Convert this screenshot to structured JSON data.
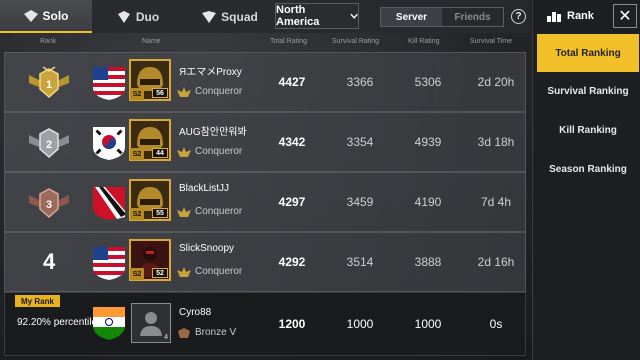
{
  "tabs": {
    "modes": [
      "Solo",
      "Duo",
      "Squad"
    ],
    "region": "North America",
    "scope_server": "Server",
    "scope_friends": "Friends",
    "help": "?"
  },
  "header": {
    "rank": "Rank",
    "name": "Name",
    "total": "Total Rating",
    "survival": "Survival Rating",
    "kill": "Kill Rating",
    "time": "Survival Time"
  },
  "rows": [
    {
      "rank": "1",
      "name": "ЯエマメProxy",
      "season": "S2",
      "level": "56",
      "tier": "Conqueror",
      "total": "4427",
      "survival": "3366",
      "kill": "5306",
      "time": "2d 20h",
      "flag_color": "#1f3f8f"
    },
    {
      "rank": "2",
      "name": "AUG참안만워봐",
      "season": "S2",
      "level": "44",
      "tier": "Conqueror",
      "total": "4342",
      "survival": "3354",
      "kill": "4939",
      "time": "3d 18h",
      "flag_color": "#ffffff"
    },
    {
      "rank": "3",
      "name": "BlackListJJ",
      "season": "S2",
      "level": "55",
      "tier": "Conqueror",
      "total": "4297",
      "survival": "3459",
      "kill": "4190",
      "time": "7d 4h",
      "flag_color": "#ce1126"
    },
    {
      "rank": "4",
      "name": "SlickSnoopy",
      "season": "S2",
      "level": "52",
      "tier": "Conqueror",
      "total": "4292",
      "survival": "3514",
      "kill": "3888",
      "time": "2d 16h",
      "flag_color": "#1f3f8f"
    }
  ],
  "my_rank": {
    "label": "My Rank",
    "percentile": "92.20% percentile",
    "name": "Cyro88",
    "level": "4",
    "tier": "Bronze V",
    "total": "1200",
    "survival": "1000",
    "kill": "1000",
    "time": "0s"
  },
  "sidebar": {
    "title": "Rank",
    "close": "✕",
    "items": [
      "Total Ranking",
      "Survival Ranking",
      "Kill Ranking",
      "Season Ranking"
    ],
    "active_index": 0
  },
  "colors": {
    "accent": "#f2c029",
    "background": "#24262a"
  }
}
